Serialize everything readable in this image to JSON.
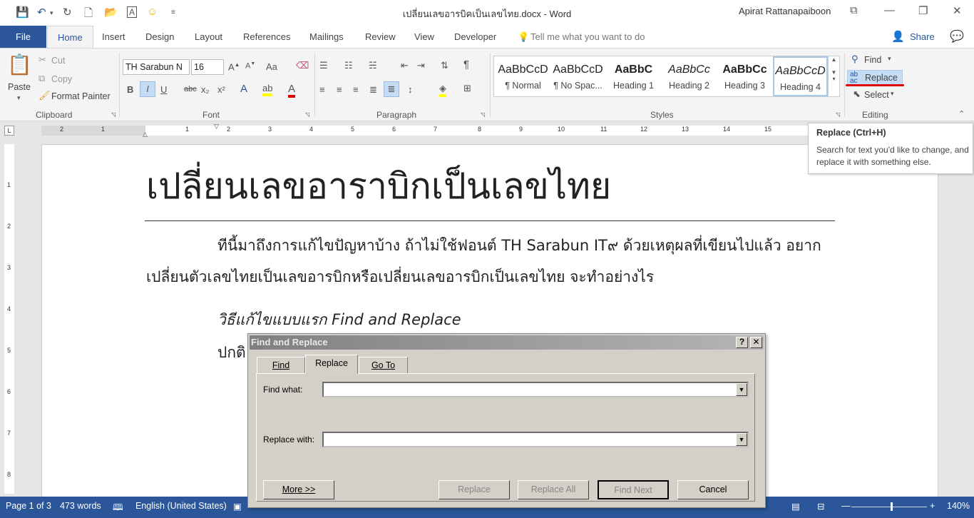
{
  "window": {
    "doc_title": "เปลี่ยนเลขอารบิคเป็นเลขไทย.docx - Word",
    "user": "Apirat Rattanapaiboon"
  },
  "tabs": {
    "file": "File",
    "items": [
      "Home",
      "Insert",
      "Design",
      "Layout",
      "References",
      "Mailings",
      "Review",
      "View",
      "Developer"
    ],
    "tell_me": "Tell me what you want to do",
    "share": "Share"
  },
  "ribbon": {
    "clipboard": {
      "paste": "Paste",
      "cut": "Cut",
      "copy": "Copy",
      "format_painter": "Format Painter",
      "label": "Clipboard"
    },
    "font": {
      "name": "TH Sarabun N",
      "size": "16",
      "label": "Font",
      "bold": "B",
      "italic": "I",
      "underline": "U",
      "strike": "abc",
      "sub": "x₂",
      "sup": "x²",
      "aa": "Aa"
    },
    "paragraph": {
      "label": "Paragraph"
    },
    "styles": {
      "label": "Styles",
      "items": [
        {
          "preview": "AaBbCcD",
          "name": "¶ Normal"
        },
        {
          "preview": "AaBbCcD",
          "name": "¶ No Spac..."
        },
        {
          "preview": "AaBbC",
          "name": "Heading 1"
        },
        {
          "preview": "AaBbCc",
          "name": "Heading 2"
        },
        {
          "preview": "AaBbCc",
          "name": "Heading 3"
        },
        {
          "preview": "AaBbCcD",
          "name": "Heading 4"
        }
      ]
    },
    "editing": {
      "find": "Find",
      "replace": "Replace",
      "select": "Select",
      "label": "Editing"
    }
  },
  "ruler": {
    "top_numbers": [
      "2",
      "1",
      "1",
      "2",
      "3",
      "4",
      "5",
      "6",
      "7",
      "8",
      "9",
      "10",
      "11",
      "12",
      "13",
      "14",
      "15"
    ],
    "left_numbers": [
      "1",
      "2",
      "3",
      "4",
      "5",
      "6",
      "7",
      "8"
    ]
  },
  "tooltip": {
    "title": "Replace (Ctrl+H)",
    "body": "Search for text you'd like to change, and replace it with something else."
  },
  "document": {
    "heading": "เปลี่ยนเลขอาราบิกเป็นเลขไทย",
    "para1_line1": "ทีนี้มาถึงการแก้ไขปัญหาบ้าง ถ้าไม่ใช้ฟอนต์ TH Sarabun IT๙ ด้วยเหตุผลที่เขียนไปแล้ว อยาก",
    "para1_line2": "เปลี่ยนตัวเลขไทยเป็นเลขอารบิกหรือเปลี่ยนเลขอารบิกเป็นเลขไทย จะทำอย่างไร",
    "para2": "วิธีแก้ไขแบบแรก Find and Replace",
    "para3": "ปกติ"
  },
  "dialog": {
    "title": "Find and Replace",
    "help": "?",
    "close": "✕",
    "tabs": [
      "Find",
      "Replace",
      "Go To"
    ],
    "find_label": "Find what:",
    "replace_label": "Replace with:",
    "buttons": {
      "more": "More >>",
      "replace": "Replace",
      "replace_all": "Replace All",
      "find_next": "Find Next",
      "cancel": "Cancel"
    }
  },
  "status": {
    "page": "Page 1 of 3",
    "words": "473 words",
    "language": "English (United States)",
    "zoom": "140%"
  },
  "colors": {
    "accent": "#2b579a",
    "highlight": "#c5dcf5",
    "annotation": "#e00000"
  }
}
